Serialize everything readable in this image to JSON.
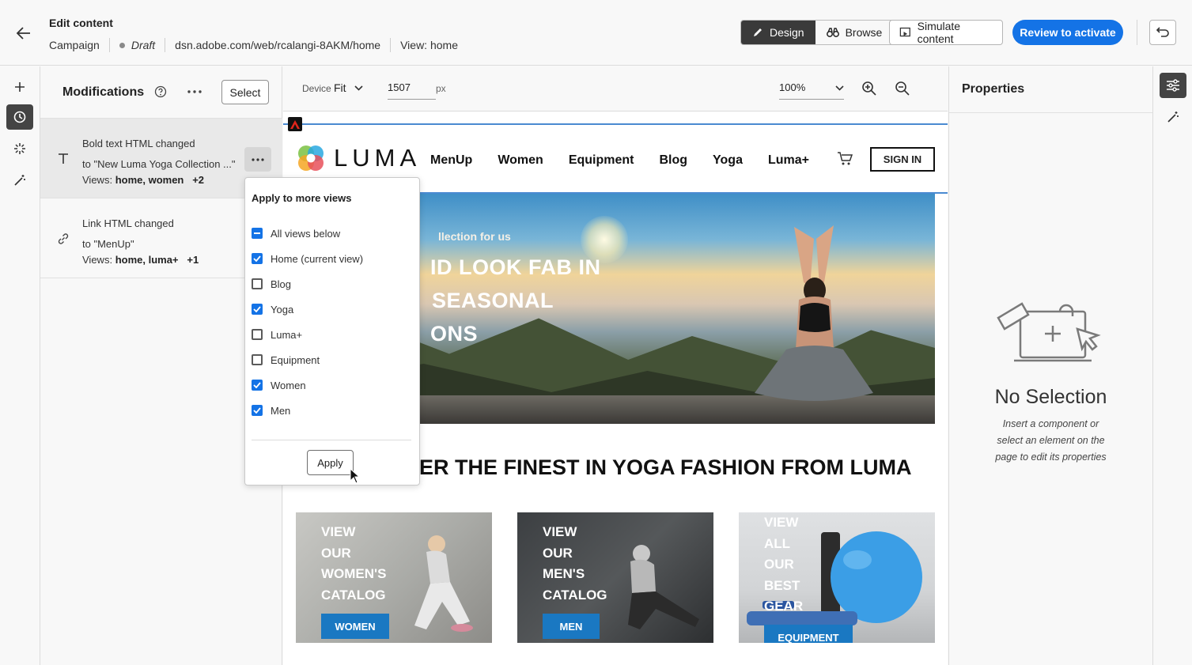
{
  "header": {
    "title": "Edit content",
    "breadcrumb": {
      "type": "Campaign",
      "status": "Draft",
      "url": "dsn.adobe.com/web/rcalangi-8AKM/home",
      "view": "View: home"
    },
    "design_label": "Design",
    "browse_label": "Browse",
    "simulate_label": "Simulate content",
    "review_label": "Review to activate"
  },
  "modifications": {
    "title": "Modifications",
    "select_label": "Select",
    "items": [
      {
        "line1": "Bold text HTML changed",
        "line2": "to \"New Luma Yoga Collection ...\"",
        "views_prefix": "Views:",
        "views": "home, women",
        "extra": "+2"
      },
      {
        "line1": "Link HTML changed",
        "line2": "to \"MenUp\"",
        "views_prefix": "Views:",
        "views": "home, luma+",
        "extra": "+1"
      }
    ]
  },
  "popover": {
    "title": "Apply to more views",
    "options": [
      {
        "label": "All views below",
        "state": "indeterminate"
      },
      {
        "label": "Home (current view)",
        "state": "checked"
      },
      {
        "label": "Blog",
        "state": "unchecked"
      },
      {
        "label": "Yoga",
        "state": "checked"
      },
      {
        "label": "Luma+",
        "state": "unchecked"
      },
      {
        "label": "Equipment",
        "state": "unchecked"
      },
      {
        "label": "Women",
        "state": "checked"
      },
      {
        "label": "Men",
        "state": "checked"
      }
    ],
    "apply_label": "Apply"
  },
  "canvas_toolbar": {
    "device_label": "Device",
    "device_value": "Fit",
    "width_value": "1507",
    "unit": "px",
    "zoom_value": "100%"
  },
  "site": {
    "logo_text": "LUMA",
    "nav": [
      "MenUp",
      "Women",
      "Equipment",
      "Blog",
      "Yoga",
      "Luma+"
    ],
    "signin_label": "SIGN IN",
    "hero_subtitle": "llection for us",
    "hero_lines": [
      "ID LOOK FAB IN",
      "SEASONAL",
      "ONS"
    ],
    "section_title": "ER THE FINEST IN YOGA FASHION FROM LUMA",
    "cards": [
      {
        "lines": [
          "VIEW",
          "OUR",
          "WOMEN'S",
          "CATALOG"
        ],
        "button": "WOMEN"
      },
      {
        "lines": [
          "VIEW",
          "OUR",
          "MEN'S",
          "CATALOG"
        ],
        "button": "MEN"
      },
      {
        "lines": [
          "VIEW",
          "ALL",
          "OUR",
          "BEST",
          "GEAR"
        ],
        "button": "EQUIPMENT"
      }
    ]
  },
  "properties": {
    "title": "Properties",
    "empty_title": "No Selection",
    "empty_desc": "Insert a component or select an element on the page to edit its properties"
  },
  "colors": {
    "accent": "#1473e6",
    "dark_button": "#3a3a3a",
    "card_button": "#1a78c2"
  }
}
